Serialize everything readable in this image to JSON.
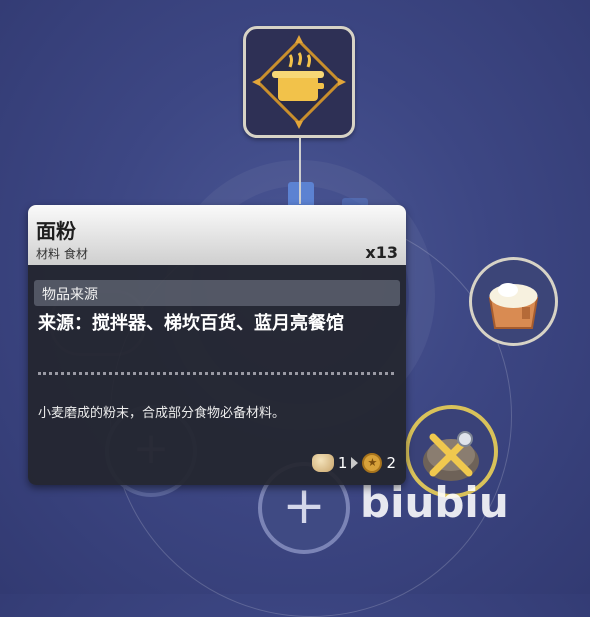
{
  "item_card": {
    "title": "面粉",
    "tags": "材料 食材",
    "quantity": "x13",
    "section_label": "物品来源",
    "source": "来源：搅拌器、梯坎百货、蓝月亮餐馆",
    "description": "小麦磨成的粉末，合成部分食物必备材料。",
    "recipe": {
      "input_icon": "flour-sack-icon",
      "input_count": "1",
      "output_icon": "gold-coin-icon",
      "output_count": "2"
    }
  },
  "nodes": {
    "top": {
      "icon": "cooking-pot-icon"
    },
    "right": {
      "icon": "flour-crate-icon"
    },
    "selected": {
      "icon": "crossed-tools-icon"
    },
    "empty_slot_symbol": "+"
  },
  "watermark": "biubiu",
  "colors": {
    "background": "#3d4784",
    "card": "#24262e",
    "selected_ring": "#d9c25a",
    "accent_gear": "#5c82d2"
  }
}
